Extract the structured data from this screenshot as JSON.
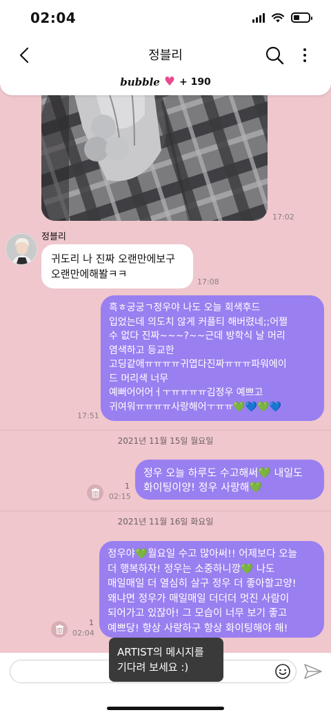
{
  "status": {
    "time": "02:04"
  },
  "header": {
    "title": "정블리"
  },
  "bubble": {
    "brand": "bubble",
    "heart": "♥",
    "count": "+ 190"
  },
  "chat": {
    "photo_time": "17:02",
    "sender_name": "정블리",
    "artist_message": "귀도리 나 진짜 오랜만에보구\n오랜만에해봘ㅋㅋ",
    "artist_time": "17:08",
    "my_message_1": "흑ㅎ궁궁ㄱ정우야 나도 오늘 회색후드\n입었는데 의도치 않게 커플티 해버렸네;;어쩔\n수 없다 진짜~~~?~~근데 방학식 날 머리\n염색하고 등교한\n고딩같애ㅠㅠㅠㅠ귀엽다진짜ㅠㅠㅠ파워에이\n드 머리색 너무\n예뻐어어어ㅓㅜㅠㅠㅠㅠ김정우 예쁘고\n귀여워ㅠㅠㅠㅠ사랑해어ㅜㅠㅠ💚💙💚💙",
    "my_message_1_time": "17:51",
    "date_1": "2021년 11월 15일 월요일",
    "my_message_2": "정우 오늘 하루도 수고해써💚 내일도\n화이팅이양! 정우 사랑해💚",
    "my_message_2_unread": "1",
    "my_message_2_time": "02:15",
    "date_2": "2021년 11월 16일 화요일",
    "my_message_3": "정우야💚월요일 수고 많아써!! 어제보다 오늘\n더 행복하자! 정우는 소중하니깡💚 나도\n매일매일 더 열심히 살구 정우 더 좋아할고양!\n왜냐면 정우가 매일매일 더더더 멋진 사람이\n되어가고 있잖아! 그 모습이 너무 보기 좋고\n예쁘당! 항상 사랑하구 항상 화이팅해야 해!",
    "my_message_3_unread": "1",
    "my_message_3_time": "02:04"
  },
  "composer": {
    "placeholder": "",
    "tooltip": "ARTIST의 메시지를\n기다려 보세요 :)"
  },
  "colors": {
    "background": "#efc7cd",
    "my_bubble": "#9a7ff0",
    "heart": "#e64c8f"
  }
}
